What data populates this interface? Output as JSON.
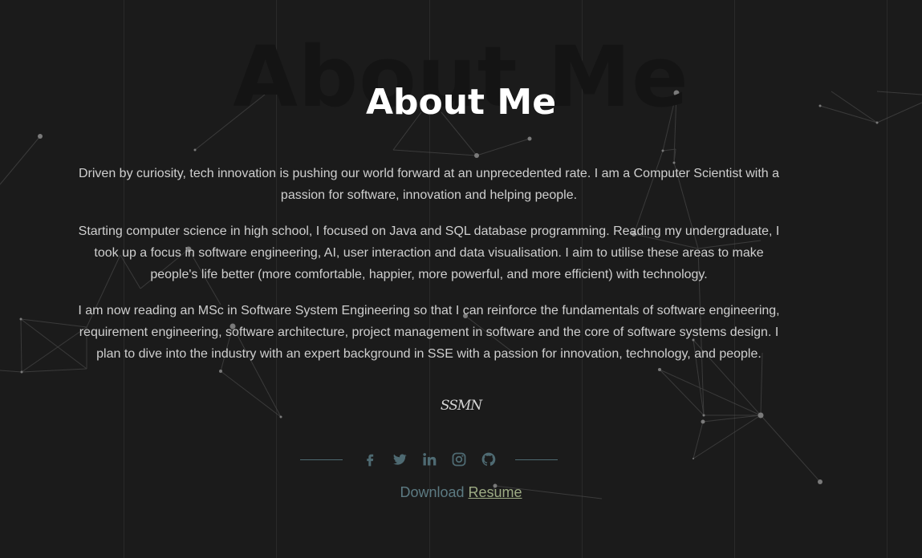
{
  "section": {
    "bg_title": "About Me",
    "title": "About Me"
  },
  "paragraphs": {
    "p1": "Driven by curiosity, tech innovation is pushing our world forward at an unprecedented rate. I am a Computer Scientist with a passion for software, innovation and helping people.",
    "p2": "Starting computer science in high school, I focused on Java and SQL database programming. Reading my undergraduate, I took up a focus in software engineering, AI, user interaction and data visualisation. I aim to utilise these areas to make people's life better (more comfortable, happier, more powerful, and more efficient) with technology.",
    "p3": "I am now reading an MSc in Software System Engineering so that I can reinforce the fundamentals of software engineering, requirement engineering, software architecture, project management in software and the core of software systems design. I plan to dive into the industry with an expert background in SSE with a passion for innovation, technology, and people."
  },
  "signature": "SSMN",
  "social": {
    "icons": [
      "facebook-icon",
      "twitter-icon",
      "linkedin-icon",
      "instagram-icon",
      "github-icon"
    ],
    "accent": "#4e6a72"
  },
  "download": {
    "prefix": "Download ",
    "link_label": "Resume"
  },
  "colors": {
    "background": "#1b1b1b",
    "text": "#cfcfcf",
    "link": "#9dab84",
    "muted": "#5c7a82"
  }
}
